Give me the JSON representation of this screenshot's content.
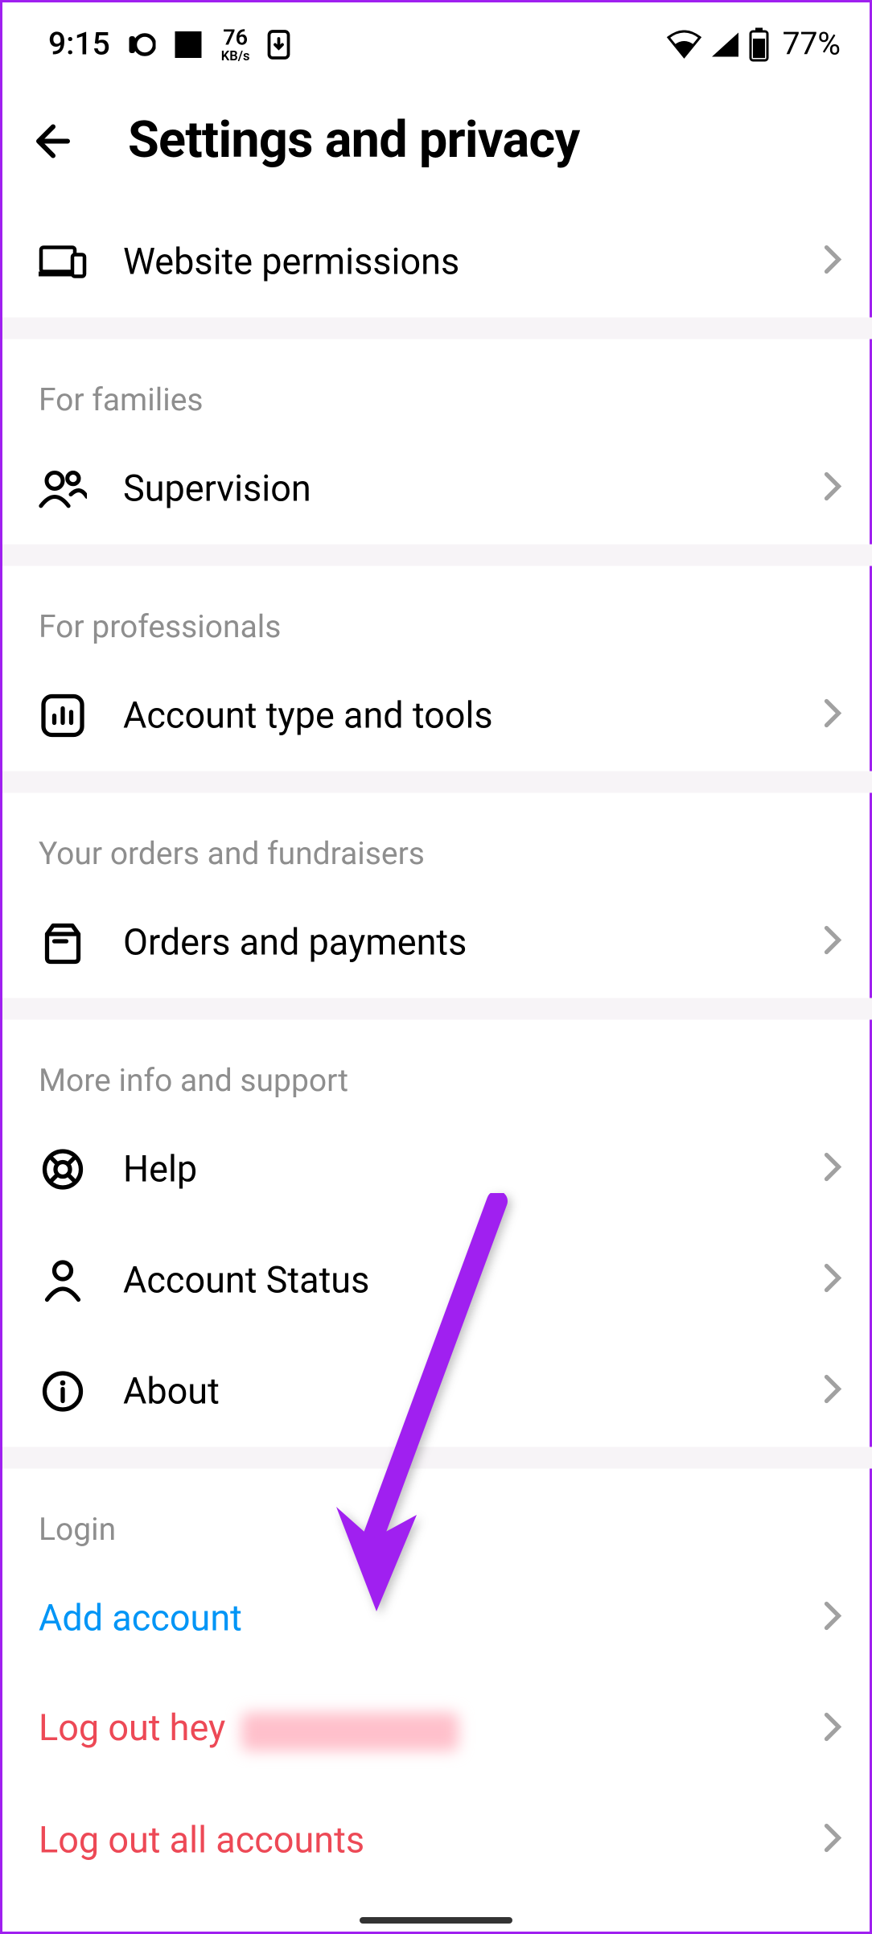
{
  "status": {
    "time": "9:15",
    "kb_rate_top": "76",
    "kb_rate_bot": "KB/s",
    "battery_pct": "77%"
  },
  "header": {
    "title": "Settings and privacy"
  },
  "items": {
    "website_permissions": "Website permissions",
    "families_header": "For families",
    "supervision": "Supervision",
    "professionals_header": "For professionals",
    "account_type_tools": "Account type and tools",
    "orders_header": "Your orders and fundraisers",
    "orders_payments": "Orders and payments",
    "support_header": "More info and support",
    "help": "Help",
    "account_status": "Account Status",
    "about": "About",
    "login_header": "Login",
    "add_account": "Add account",
    "logout_user_prefix": "Log out hey",
    "logout_all": "Log out all accounts"
  }
}
